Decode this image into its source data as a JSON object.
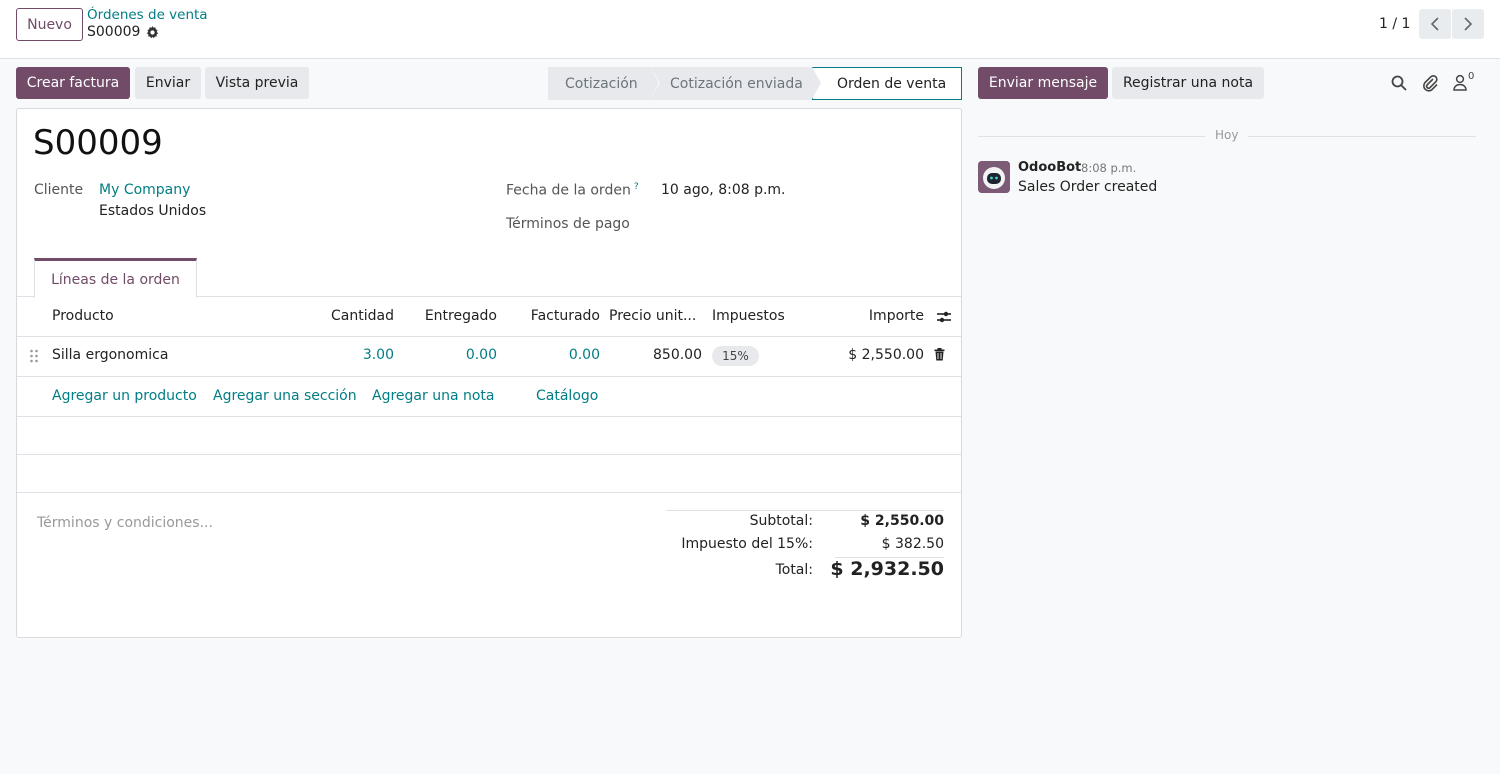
{
  "control_panel": {
    "new_button": "Nuevo",
    "breadcrumb_parent": "Órdenes de venta",
    "breadcrumb_current": "S00009",
    "pager_value": "1 / 1"
  },
  "actions": {
    "create_invoice": "Crear factura",
    "send": "Enviar",
    "preview": "Vista previa"
  },
  "statusbar": {
    "stages": [
      "Cotización",
      "Cotización enviada",
      "Orden de venta"
    ],
    "active": "Orden de venta"
  },
  "form": {
    "name": "S00009",
    "customer_label": "Cliente",
    "customer_name": "My Company",
    "customer_country": "Estados Unidos",
    "date_label": "Fecha de la orden",
    "date_help": "?",
    "date_value": "10 ago, 8:08 p.m.",
    "payment_terms_label": "Términos de pago",
    "tab_label": "Líneas de la orden",
    "columns": {
      "product": "Producto",
      "quantity": "Cantidad",
      "delivered": "Entregado",
      "invoiced": "Facturado",
      "unit_price": "Precio unit...",
      "taxes": "Impuestos",
      "amount": "Importe"
    },
    "lines": [
      {
        "product": "Silla ergonomica",
        "quantity": "3.00",
        "delivered": "0.00",
        "invoiced": "0.00",
        "unit_price": "850.00",
        "tax": "15%",
        "amount": "$ 2,550.00"
      }
    ],
    "add_links": {
      "product": "Agregar un producto",
      "section": "Agregar una sección",
      "note": "Agregar una nota",
      "catalog": "Catálogo"
    },
    "terms_placeholder": "Términos y condiciones...",
    "totals": {
      "subtotal_label": "Subtotal:",
      "subtotal_value": "$ 2,550.00",
      "tax_label": "Impuesto del 15%:",
      "tax_value": "$ 382.50",
      "total_label": "Total:",
      "total_value": "$ 2,932.50"
    }
  },
  "chatter": {
    "send_message": "Enviar mensaje",
    "log_note": "Registrar una nota",
    "followers_count": "0",
    "date_separator": "Hoy",
    "messages": [
      {
        "author": "OdooBot",
        "time": "8:08 p.m.",
        "body": "Sales Order created"
      }
    ]
  },
  "colors": {
    "brand": "#714b67",
    "link": "#017e84"
  }
}
